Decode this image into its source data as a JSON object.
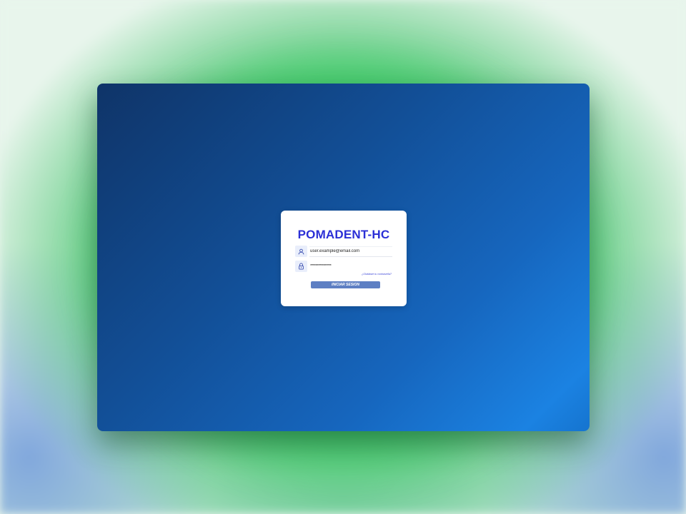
{
  "login": {
    "title": "POMADENT-HC",
    "email": {
      "value": "user.example@email.com",
      "icon": "user-icon"
    },
    "password": {
      "value": "****************",
      "icon": "lock-icon"
    },
    "forgot_label": "¿Olvidaste tu contraseña?",
    "submit_label": "INICIAR SESION"
  },
  "colors": {
    "title": "#2b2fd6",
    "button": "#5d7fc3",
    "link": "#3a45d8",
    "window_gradient_start": "#0f3468",
    "window_gradient_end": "#1b82e2"
  }
}
